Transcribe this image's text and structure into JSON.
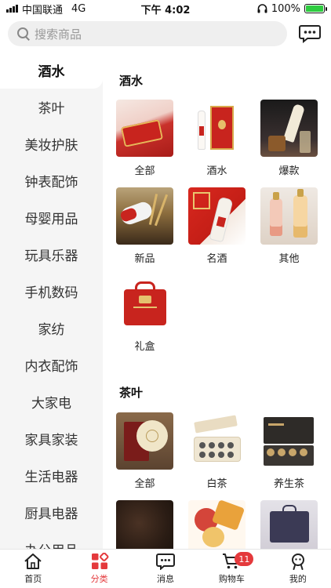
{
  "status_bar": {
    "carrier": "中国联通",
    "network": "4G",
    "time": "下午 4:02",
    "battery": "100%",
    "battery_level": 1.0
  },
  "search": {
    "placeholder": "搜索商品",
    "search_icon": "search-icon",
    "message_icon": "message-dots-icon"
  },
  "sidebar": {
    "items": [
      {
        "label": "酒水",
        "active": true
      },
      {
        "label": "茶叶"
      },
      {
        "label": "美妆护肤"
      },
      {
        "label": "钟表配饰"
      },
      {
        "label": "母婴用品"
      },
      {
        "label": "玩具乐器"
      },
      {
        "label": "手机数码"
      },
      {
        "label": "家纺"
      },
      {
        "label": "内衣配饰"
      },
      {
        "label": "大家电"
      },
      {
        "label": "家具家装"
      },
      {
        "label": "生活电器"
      },
      {
        "label": "厨具电器"
      },
      {
        "label": "办公用品"
      }
    ]
  },
  "sections": [
    {
      "title": "酒水",
      "items": [
        {
          "label": "全部"
        },
        {
          "label": "酒水"
        },
        {
          "label": "爆款"
        },
        {
          "label": "新品"
        },
        {
          "label": "名酒"
        },
        {
          "label": "其他"
        },
        {
          "label": "礼盒"
        }
      ]
    },
    {
      "title": "茶叶",
      "items": [
        {
          "label": "全部"
        },
        {
          "label": "白茶"
        },
        {
          "label": "养生茶"
        },
        {
          "label": ""
        },
        {
          "label": ""
        },
        {
          "label": ""
        }
      ]
    }
  ],
  "tabbar": {
    "tabs": [
      {
        "label": "首页",
        "icon": "home-icon"
      },
      {
        "label": "分类",
        "icon": "category-icon",
        "active": true
      },
      {
        "label": "消息",
        "icon": "message-icon"
      },
      {
        "label": "购物车",
        "icon": "cart-icon",
        "badge": "11"
      },
      {
        "label": "我的",
        "icon": "profile-icon"
      }
    ]
  },
  "colors": {
    "accent": "#e4393c",
    "sidebar_bg": "#f5f5f5",
    "search_bg": "#efefef"
  }
}
